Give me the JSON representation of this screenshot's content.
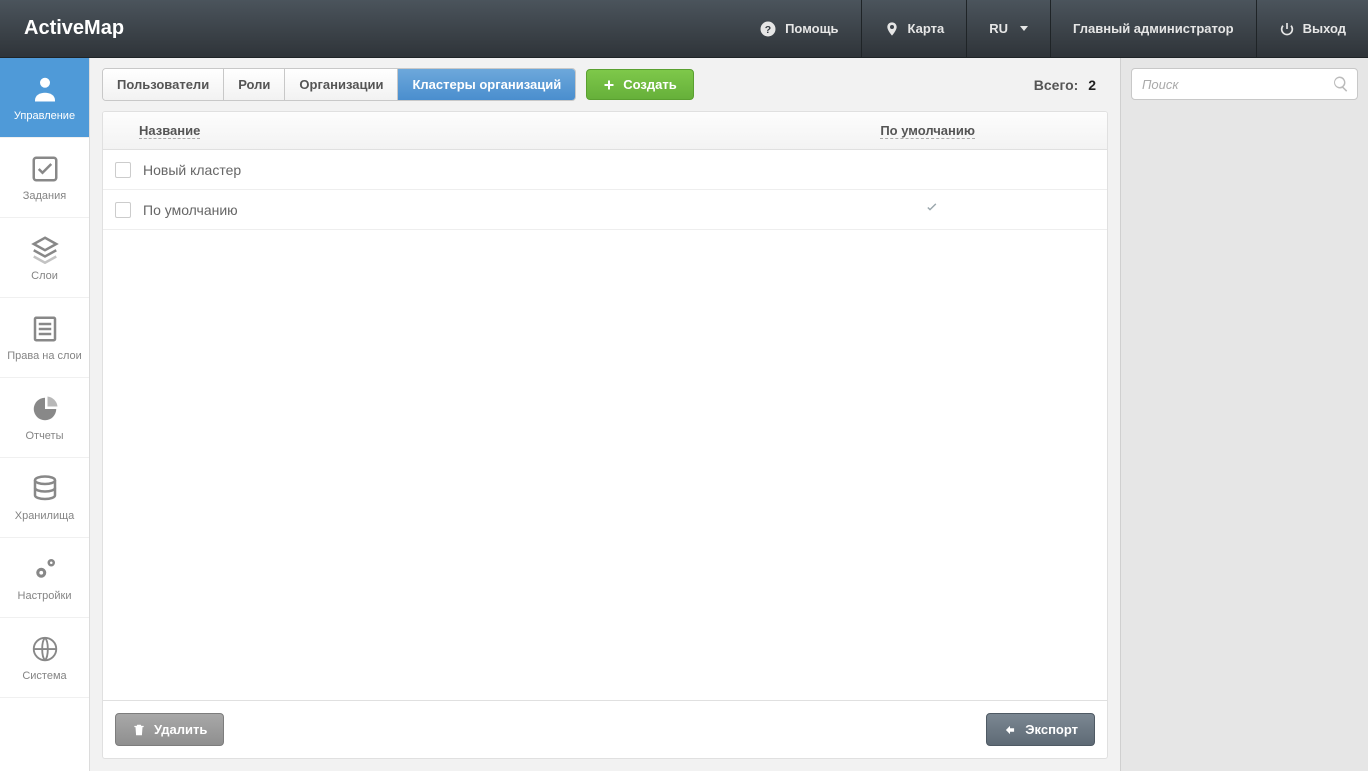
{
  "header": {
    "logo": "ActiveMap",
    "help": "Помощь",
    "map": "Карта",
    "lang": "RU",
    "user": "Главный администратор",
    "logout": "Выход"
  },
  "sidebar": {
    "items": [
      {
        "label": "Управление"
      },
      {
        "label": "Задания"
      },
      {
        "label": "Слои"
      },
      {
        "label": "Права на слои"
      },
      {
        "label": "Отчеты"
      },
      {
        "label": "Хранилища"
      },
      {
        "label": "Настройки"
      },
      {
        "label": "Система"
      }
    ]
  },
  "tabs": {
    "users": "Пользователи",
    "roles": "Роли",
    "orgs": "Организации",
    "clusters": "Кластеры организаций"
  },
  "toolbar": {
    "create": "Создать",
    "total_label": "Всего:",
    "total_value": "2"
  },
  "table": {
    "col_name": "Название",
    "col_default": "По умолчанию",
    "rows": [
      {
        "name": "Новый кластер",
        "default": false
      },
      {
        "name": "По умолчанию",
        "default": true
      }
    ]
  },
  "bottom": {
    "delete": "Удалить",
    "export": "Экспорт"
  },
  "search": {
    "placeholder": "Поиск"
  }
}
